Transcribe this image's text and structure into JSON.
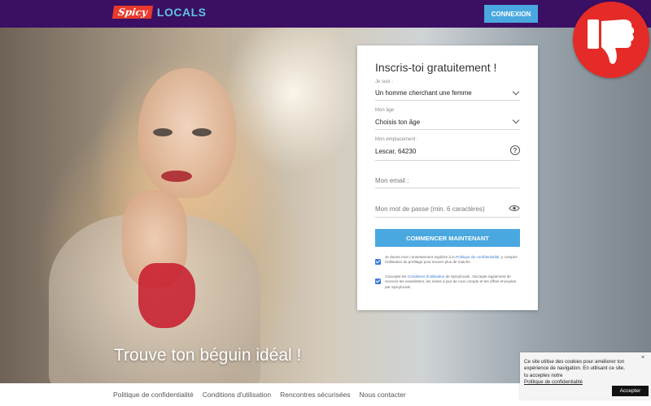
{
  "header": {
    "logo_spicy": "Spicy",
    "logo_locals": "LOCALS",
    "login_label": "CONNEXION"
  },
  "hero": {
    "tagline": "Trouve ton béguin idéal !"
  },
  "form": {
    "title": "Inscris-toi gratuitement !",
    "i_am": {
      "label": "Je suis :",
      "value": "Un homme cherchant une femme"
    },
    "age": {
      "label": "Mon âge",
      "value": "Choisis ton âge"
    },
    "location": {
      "label": "Mon emplacement :",
      "value": "Lescar, 64230"
    },
    "email": {
      "placeholder": "Mon email :"
    },
    "password": {
      "placeholder": "Mon mot de passe (min. 6 caractères)"
    },
    "submit_label": "COMMENCER MAINTENANT",
    "consent1": {
      "prefix": "Je donne mon consentement explicite à la ",
      "link": "Politique de confidentialité",
      "suffix": ", y compris l'utilisation du profilage pour trouver plus de matchs."
    },
    "consent2": {
      "prefix": "J'accepte les ",
      "link": "Conditions d'utilisation",
      "suffix": " de Spicylocals. J'accepte également de recevoir les newsletters, les mises à jour de mon compte et les offres envoyées par Spicylocals."
    }
  },
  "footer": {
    "links": [
      "Politique de confidentialité",
      "Conditions d'utilisation",
      "Rencontres sécurisées",
      "Nous contacter"
    ]
  },
  "cookie": {
    "text": "Ce site utilise des cookies pour améliorer ton expérience de navigation. En utilisant ce site, tu acceptes notre",
    "link": "Politique de confidentialité",
    "accept_label": "Accepter",
    "close": "×"
  },
  "colors": {
    "header_bg": "#3b0f63",
    "accent_blue": "#4aa8e0",
    "logo_red": "#e8392c",
    "badge_red": "#e42b27"
  },
  "icons": {
    "badge": "thumbs-down-icon",
    "location_help": "question-circle-icon",
    "password_toggle": "eye-icon"
  }
}
